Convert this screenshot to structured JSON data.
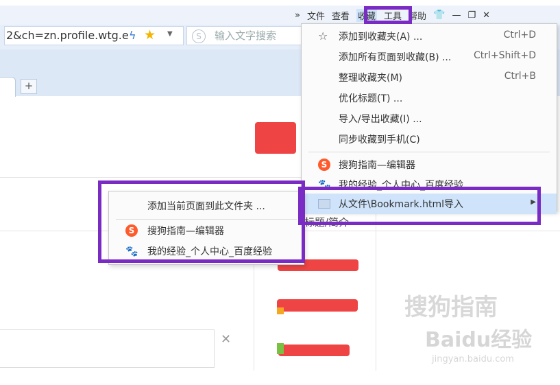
{
  "menubar": {
    "items": [
      "»",
      "文件",
      "查看",
      "收藏",
      "工具",
      "帮助"
    ]
  },
  "address": {
    "url": "2&ch=zn.profile.wtg.e"
  },
  "search": {
    "placeholder": "输入文字搜索"
  },
  "tabs": {
    "new_tab": "+"
  },
  "favorites_menu": {
    "items": [
      {
        "label": "添加到收藏夹(A) ...",
        "shortcut": "Ctrl+D",
        "icon": "star-outline-icon"
      },
      {
        "label": "添加所有页面到收藏(B) ...",
        "shortcut": "Ctrl+Shift+D"
      },
      {
        "label": "整理收藏夹(M)",
        "shortcut": "Ctrl+B"
      },
      {
        "label": "优化标题(T) ..."
      },
      {
        "label": "导入/导出收藏(I) ..."
      },
      {
        "label": "同步收藏到手机(C)"
      }
    ],
    "bookmarks": [
      {
        "label": "搜狗指南—编辑器",
        "icon": "sogou-icon"
      },
      {
        "label": "我的经验_个人中心_百度经验",
        "icon": "baidu-paw-icon"
      }
    ],
    "folder_item": {
      "label": "从文件\\Bookmark.html导入",
      "icon": "folder-icon"
    }
  },
  "submenu": {
    "add_current": "添加当前页面到此文件夹 ...",
    "items": [
      {
        "label": "搜狗指南—编辑器",
        "icon": "sogou-icon"
      },
      {
        "label": "我的经验_个人中心_百度经验",
        "icon": "baidu-paw-icon"
      }
    ]
  },
  "page": {
    "partial_text": "标题/简介"
  },
  "watermark": {
    "sogou": "搜狗指南",
    "baidu": "Baidu经验",
    "url": "jingyan.baidu.com"
  },
  "colors": {
    "highlight_box": "#7a2bc4",
    "menu_hover": "#cfe4fb",
    "redaction": "#ee4444"
  }
}
